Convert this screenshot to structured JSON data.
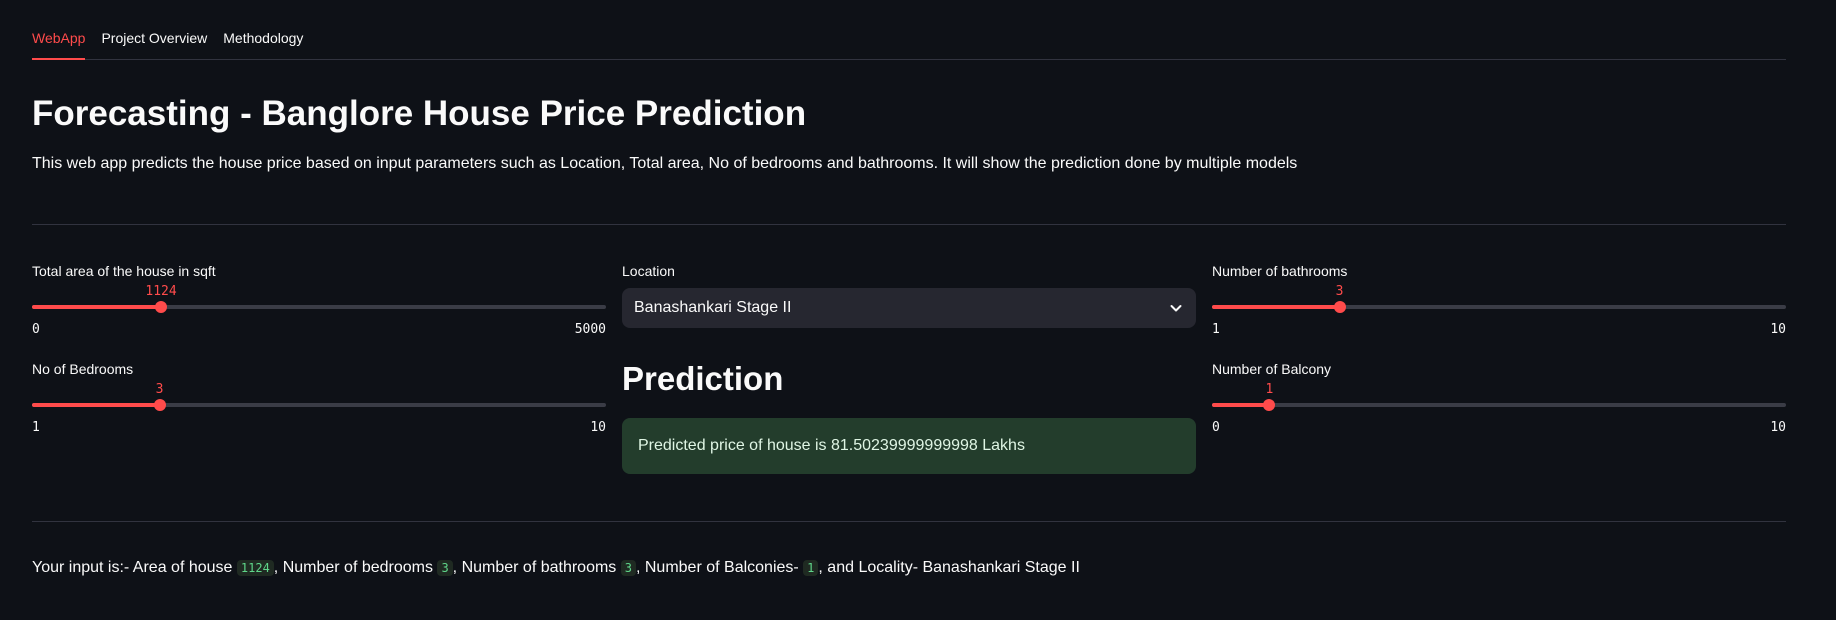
{
  "tabs": [
    {
      "label": "WebApp",
      "active": true
    },
    {
      "label": "Project Overview",
      "active": false
    },
    {
      "label": "Methodology",
      "active": false
    }
  ],
  "title": "Forecasting - Banglore House Price Prediction",
  "description": "This web app predicts the house price based on input parameters such as Location, Total area, No of bedrooms and bathrooms. It will show the prediction done by multiple models",
  "sliders": {
    "area": {
      "label": "Total area of the house in sqft",
      "value": "1124",
      "min": "0",
      "max": "5000",
      "fraction": 0.2248
    },
    "bedrooms": {
      "label": "No of Bedrooms",
      "value": "3",
      "min": "1",
      "max": "10",
      "fraction": 0.2222
    },
    "bathrooms": {
      "label": "Number of bathrooms",
      "value": "3",
      "min": "1",
      "max": "10",
      "fraction": 0.2222
    },
    "balcony": {
      "label": "Number of Balcony",
      "value": "1",
      "min": "0",
      "max": "10",
      "fraction": 0.1
    }
  },
  "location": {
    "label": "Location",
    "selected": "Banashankari Stage II"
  },
  "prediction": {
    "heading": "Prediction",
    "message": "Predicted price of house is 81.50239999999998 Lakhs"
  },
  "summary": {
    "prefix": "Your input is:- Area of house",
    "area": "1124",
    "bedrooms_text": ", Number of bedrooms",
    "bedrooms": "3",
    "bathrooms_text": ", Number of bathrooms",
    "bathrooms": "3",
    "balconies_text": ", Number of Balconies-",
    "balconies": "1",
    "locality_text": ", and Locality- Banashankari Stage II"
  },
  "colors": {
    "background": "#0e1117",
    "accent": "#ff4b4b",
    "success_bg": "#233d2c",
    "input_bg": "#262730"
  },
  "icons": {
    "select_chevron": "chevron-down-icon"
  }
}
